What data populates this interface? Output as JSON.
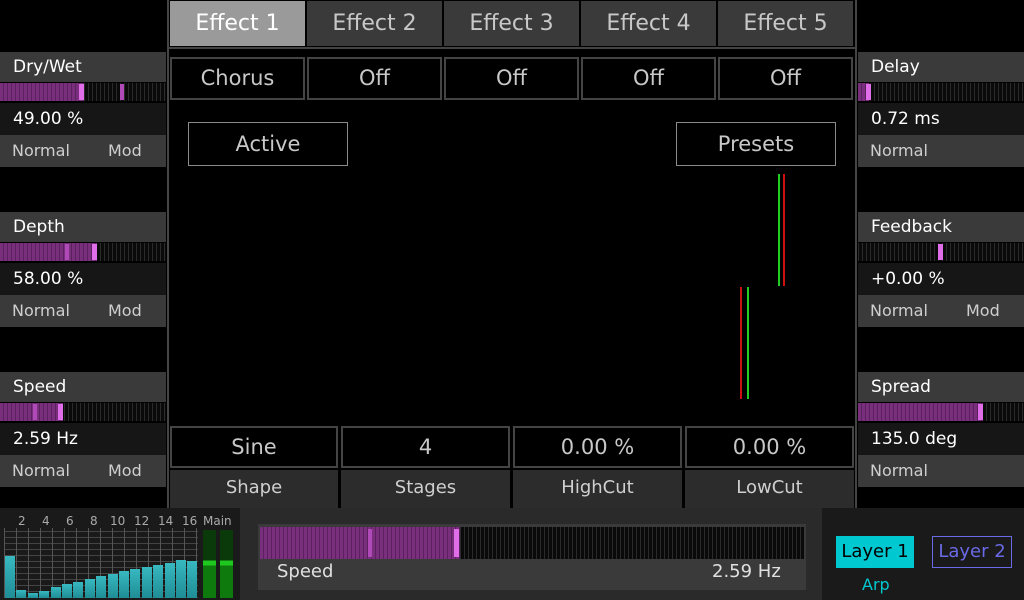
{
  "tabs": [
    "Effect 1",
    "Effect 2",
    "Effect 3",
    "Effect 4",
    "Effect 5"
  ],
  "slots": [
    "Chorus",
    "Off",
    "Off",
    "Off",
    "Off"
  ],
  "active_label": "Active",
  "presets_label": "Presets",
  "left_params": [
    {
      "title": "Dry/Wet",
      "value": "49.00 %",
      "mode_a": "Normal",
      "mode_b": "Mod",
      "level": 0.49
    },
    {
      "title": "Depth",
      "value": "58.00 %",
      "mode_a": "Normal",
      "mode_b": "Mod",
      "level": 0.58
    },
    {
      "title": "Speed",
      "value": "2.59 Hz",
      "mode_a": "Normal",
      "mode_b": "Mod",
      "level": 0.37
    }
  ],
  "right_params": [
    {
      "title": "Delay",
      "value": "0.72 ms",
      "mode_a": "Normal",
      "mode_b": "",
      "level": 0.07
    },
    {
      "title": "Feedback",
      "value": "+0.00 %",
      "mode_a": "Normal",
      "mode_b": "Mod",
      "level": 0.5
    },
    {
      "title": "Spread",
      "value": "135.0 deg",
      "mode_a": "Normal",
      "mode_b": "",
      "level": 0.75
    }
  ],
  "sub_params": [
    {
      "value": "Sine",
      "label": "Shape"
    },
    {
      "value": "4",
      "label": "Stages"
    },
    {
      "value": "0.00 %",
      "label": "HighCut"
    },
    {
      "value": "0.00 %",
      "label": "LowCut"
    }
  ],
  "mixer": {
    "channels": [
      "2",
      "4",
      "6",
      "8",
      "10",
      "12",
      "14",
      "16"
    ],
    "main_label": "Main",
    "levels": [
      0.62,
      0.12,
      0.08,
      0.1,
      0.16,
      0.2,
      0.24,
      0.28,
      0.32,
      0.36,
      0.4,
      0.42,
      0.46,
      0.48,
      0.52,
      0.56,
      0.54
    ]
  },
  "bottom_slider": {
    "label": "Speed",
    "value": "2.59 Hz",
    "level": 0.37
  },
  "layers": {
    "layer1": "Layer 1",
    "layer2": "Layer 2",
    "arp": "Arp"
  },
  "colors": {
    "accent": "#00c8d0",
    "layer2": "#6a6ae8",
    "mod_fill": "#7a2f7c",
    "marker": "#e06ee8",
    "green": "#22cc22",
    "red": "#cc1111"
  }
}
